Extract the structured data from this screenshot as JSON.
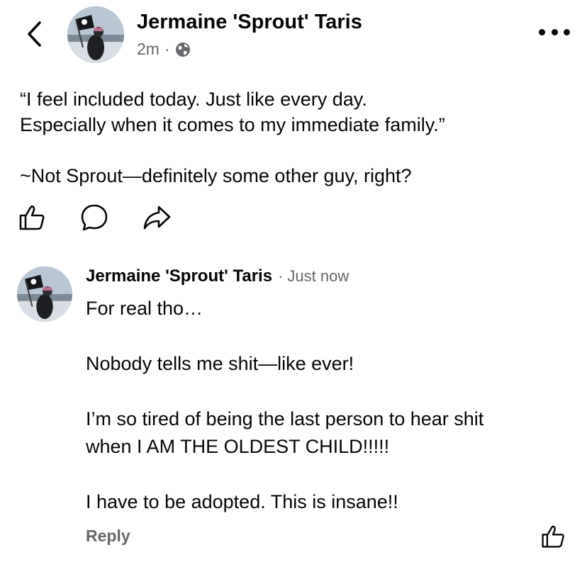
{
  "icons": {
    "back": "chevron-left-icon",
    "more": "more-horizontal-icon",
    "audience": "globe-icon",
    "like": "thumbs-up-icon",
    "comment": "comment-bubble-icon",
    "share": "share-arrow-icon"
  },
  "post": {
    "author": "Jermaine 'Sprout' Taris",
    "time": "2m",
    "separator": "·",
    "body": "“I feel included today. Just like every day.\nEspecially when it comes to my immediate family.”\n\n~Not Sprout—definitely some other guy, right?"
  },
  "comment": {
    "author": "Jermaine 'Sprout' Taris",
    "separator": "·",
    "time": "Just now",
    "body": "For real tho…\n\nNobody tells me shit—like ever!\n\nI’m so tired of being the last person to hear shit\nwhen I AM THE OLDEST CHILD!!!!!\n\nI have to be adopted. This is insane!!",
    "reply_label": "Reply"
  }
}
